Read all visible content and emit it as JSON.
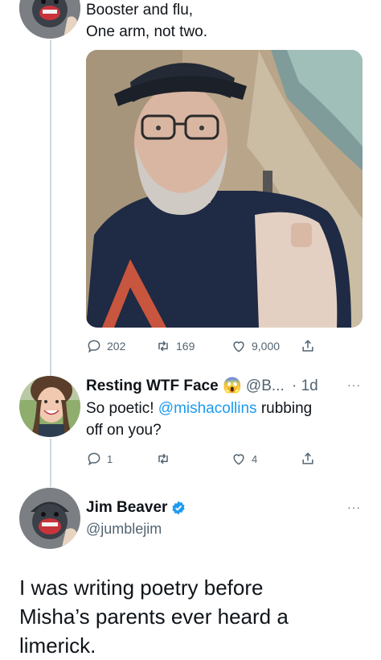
{
  "tweet1": {
    "text_lines": [
      "Booster and flu,",
      "One arm, not two."
    ],
    "photo_icon": "selfie-photo",
    "stats": {
      "replies": "202",
      "retweets": "169",
      "likes": "9,000"
    }
  },
  "reply": {
    "author_name": "Resting WTF Face",
    "emoji": "😱",
    "handle": "@B...",
    "time": "· 1d",
    "more": "···",
    "text_before": "So poetic! ",
    "mention": "@mishacollins",
    "text_after_line1": " rubbing",
    "text_line2": "off on you?",
    "stats": {
      "replies": "1",
      "retweets": "",
      "likes": "4"
    }
  },
  "main_tweet": {
    "author_name": "Jim Beaver",
    "verified_icon": "verified-badge-icon",
    "handle": "@jumblejim",
    "more": "···",
    "body_lines": [
      "I was writing poetry before",
      "Misha’s parents ever heard a",
      "limerick."
    ]
  },
  "colors": {
    "accent": "#1d9bf0",
    "muted": "#536471",
    "line": "#cfd9de"
  }
}
